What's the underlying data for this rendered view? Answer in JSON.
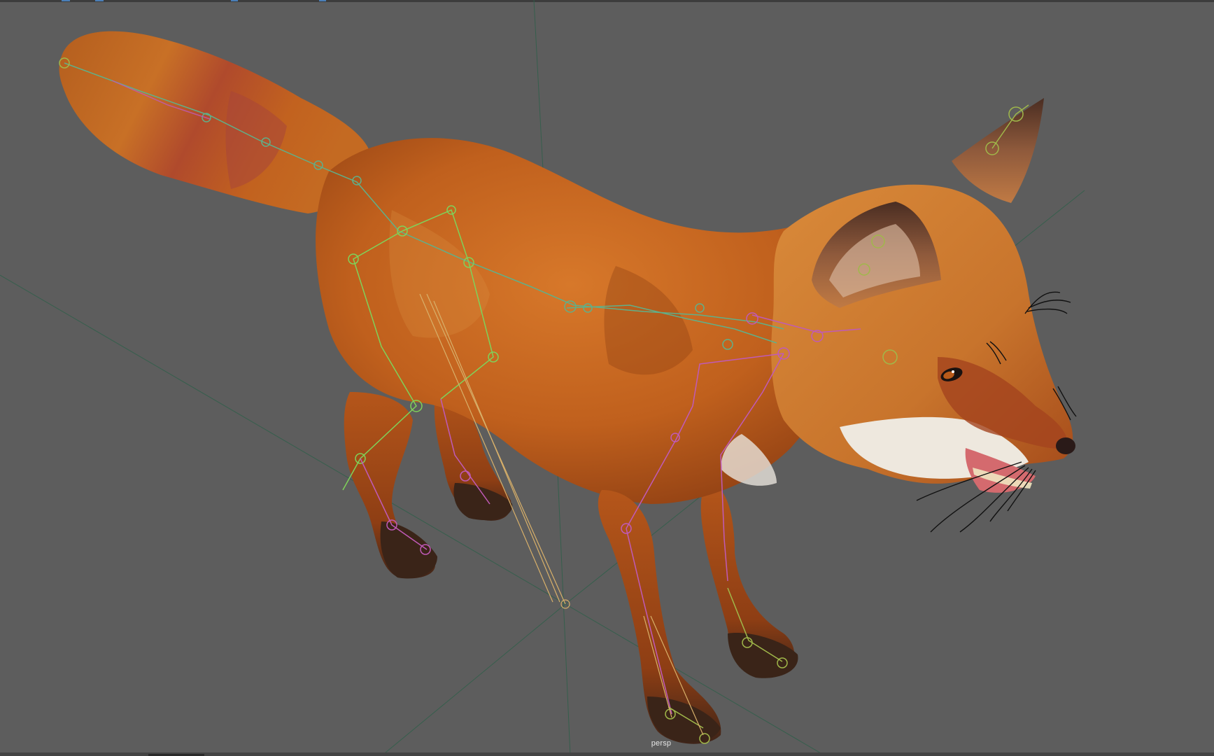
{
  "viewport": {
    "camera_label": "persp",
    "background_color": "#5d5d5d",
    "grid_color": "#2f5f4a",
    "axis_y_color": "#2e6b55"
  },
  "scene": {
    "object": "fox",
    "fur_colors": {
      "main": "#c8661f",
      "dark": "#8a3c12",
      "light": "#e69a4a",
      "white": "#e8e4dc",
      "paw_dark": "#3a2418"
    },
    "rig_colors": {
      "spine": "#5fb08a",
      "left_limbs": "#7fd25a",
      "right_limbs": "#c05ab8",
      "ik_handle": "#d8b06a",
      "joint_blue": "#6a8ac8"
    }
  }
}
